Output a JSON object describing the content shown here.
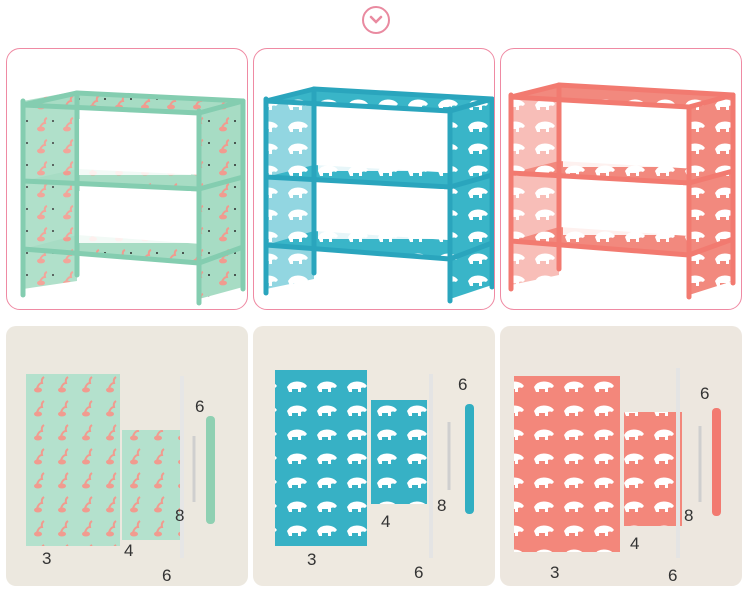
{
  "accent": "#ef8aa3",
  "badge_icon": "chevron-down-icon",
  "variants": [
    {
      "name": "green-flamingo",
      "color": "#9fd8bf",
      "frame": "#84cdb0",
      "print": "flamingo"
    },
    {
      "name": "blue-polar-bear",
      "color": "#36b3c7",
      "frame": "#2aa5bd",
      "print": "polar-bear"
    },
    {
      "name": "pink-polar-bear",
      "color": "#f08a80",
      "frame": "#f27a70",
      "print": "polar-bear"
    }
  ],
  "parts": [
    {
      "big_panel": "3",
      "small_panel": "4",
      "rod": "6",
      "side_rail": "6",
      "short_tube": "8"
    },
    {
      "big_panel": "3",
      "small_panel": "4",
      "rod": "6",
      "side_rail": "6",
      "short_tube": "8"
    },
    {
      "big_panel": "3",
      "small_panel": "4",
      "rod": "6",
      "side_rail": "6",
      "short_tube": "8"
    }
  ]
}
